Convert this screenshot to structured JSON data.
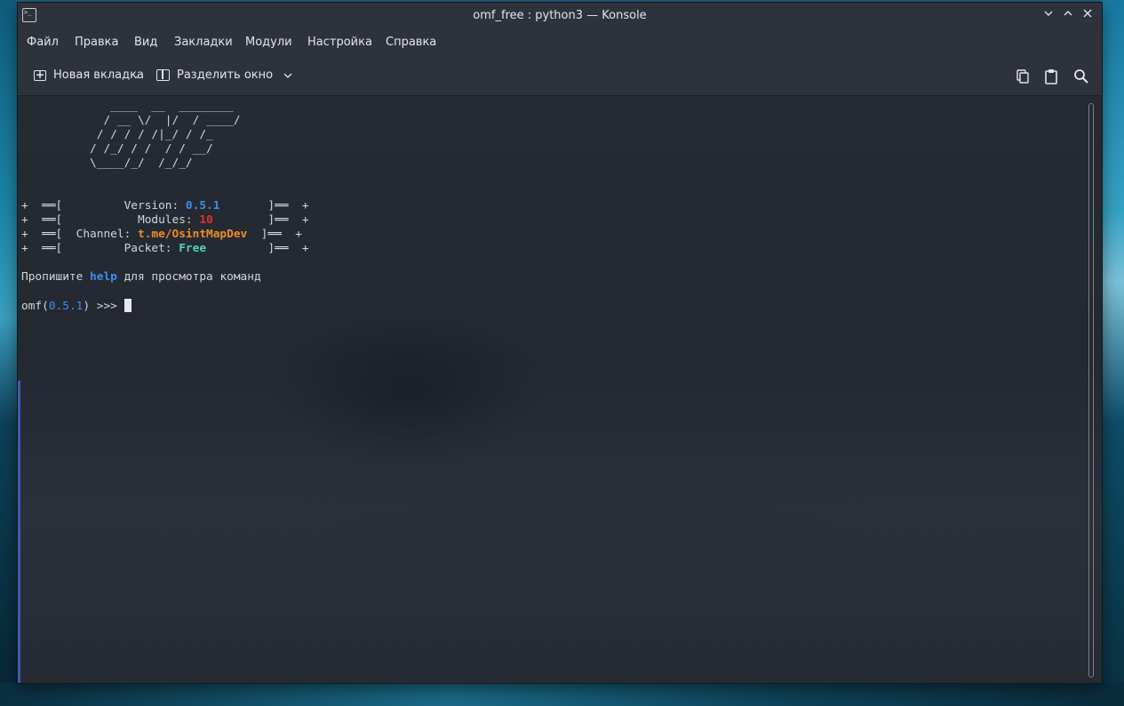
{
  "window": {
    "title": "omf_free : python3 — Konsole",
    "controls": [
      "chevron-down-icon",
      "chevron-up-icon",
      "close-icon"
    ]
  },
  "menu": {
    "items": [
      "Файл",
      "Правка",
      "Вид",
      "Закладки",
      "Модули",
      "Настройка",
      "Справка"
    ]
  },
  "toolbar": {
    "new_tab_label": "Новая вкладка",
    "split_label": "Разделить окно",
    "right_icons": [
      "copy-icon",
      "paste-icon",
      "search-icon"
    ]
  },
  "terminal": {
    "banner": [
      "             ____  __  ________",
      "            / __ \\/  |/  / ____/",
      "           / / / / /|_/ / /_",
      "          / /_/ / /  / / __/",
      "          \\____/_/  /_/_/"
    ],
    "info": [
      {
        "prefix": "+  ══[         ",
        "label": "Version: ",
        "value": "0.5.1",
        "suffix": "       ]══  +"
      },
      {
        "prefix": "+  ══[           ",
        "label": "Modules: ",
        "value": "10",
        "suffix": "        ]══  +"
      },
      {
        "prefix": "+  ══[  ",
        "label": "Channel: ",
        "value": "t.me/OsintMapDev",
        "suffix": "  ]══  +"
      },
      {
        "prefix": "+  ══[         ",
        "label": "Packet: ",
        "value": "Free",
        "suffix": "         ]══  +"
      }
    ],
    "hint_before": "Пропишите ",
    "hint_keyword": "help",
    "hint_after": " для просмотра команд",
    "prompt_prefix": "omf(",
    "prompt_version": "0.5.1",
    "prompt_suffix": ") >>> "
  },
  "colors": {
    "accent_blue": "#3d8ef0",
    "modules_red": "#e0302e",
    "channel_orange": "#ef8c2a",
    "packet_green": "#4fd6a8"
  }
}
